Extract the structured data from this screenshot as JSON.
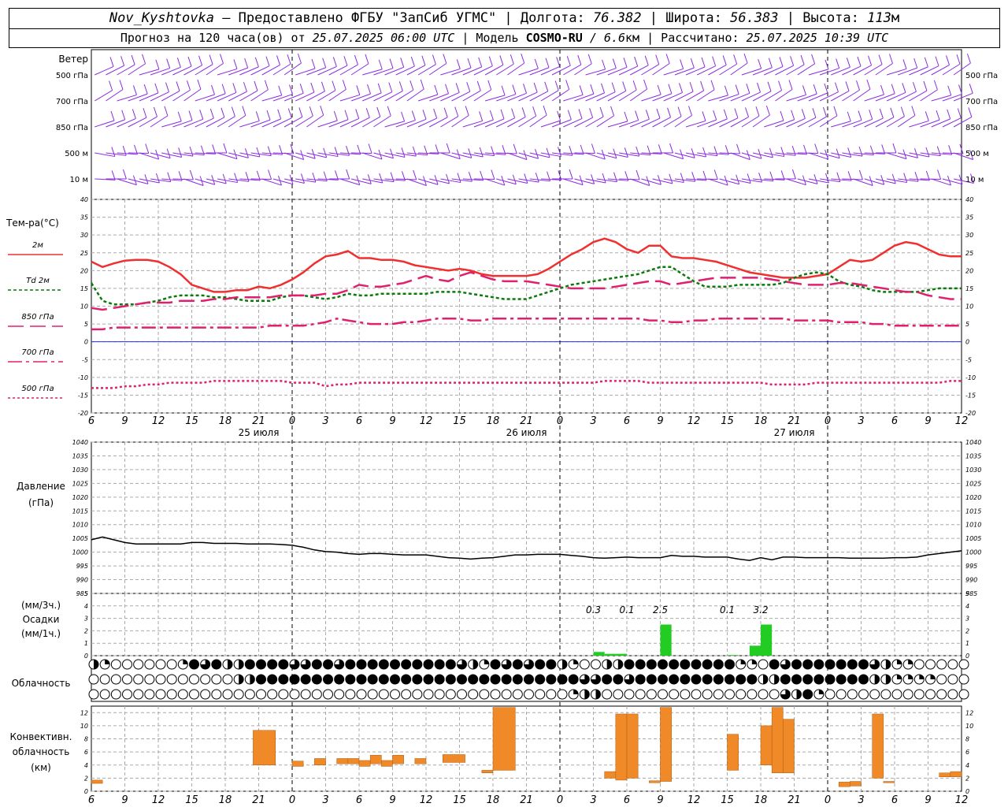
{
  "header": {
    "station": "Nov_Kyshtovka",
    "provided_by": "– Предоставлено ФГБУ \"ЗапСиб УГМС\"",
    "lon_label": "Долгота:",
    "lon_value": "76.382",
    "lat_label": "Широта:",
    "lat_value": "56.383",
    "alt_label": "Высота:",
    "alt_value": "113",
    "alt_unit": "м",
    "forecast_prefix": "Прогноз на 120 часа(ов) от",
    "forecast_time": "25.07.2025 06:00 UTC",
    "model_label": "| Модель",
    "model_name": "COSMO-RU",
    "model_res": "/ 6.6",
    "model_res_unit": "км",
    "computed_label": "| Рассчитано:",
    "computed_time": "25.07.2025 10:39 UTC"
  },
  "x_axis": {
    "hour_labels": [
      "6",
      "9",
      "12",
      "15",
      "18",
      "21",
      "0",
      "3",
      "6",
      "9",
      "12",
      "15",
      "18",
      "21",
      "0",
      "3",
      "6",
      "9",
      "12",
      "15",
      "18",
      "21",
      "0",
      "3",
      "6",
      "9",
      "12"
    ],
    "day_labels": [
      {
        "text": "25 июля",
        "hour": 15
      },
      {
        "text": "26 июля",
        "hour": 39
      },
      {
        "text": "27 июля",
        "hour": 63
      }
    ],
    "midnight_hours": [
      18,
      42,
      66
    ]
  },
  "wind_panel": {
    "title": "Ветер",
    "levels": [
      "500 гПа",
      "700 гПа",
      "850 гПа",
      "500 м",
      "10 м"
    ],
    "barb_color": "#8a2be2"
  },
  "temp_panel": {
    "title": "Тем-ра(°C)",
    "ylim": [
      -20,
      40
    ],
    "yticks": [
      40,
      35,
      30,
      25,
      20,
      15,
      10,
      5,
      0,
      -5,
      -10,
      -15,
      -20
    ],
    "legend": [
      {
        "label": "2м",
        "color": "#f03030"
      },
      {
        "label": "Td  2м",
        "color": "#0a7a0a"
      },
      {
        "label": "850 гПа",
        "color": "#e0206e"
      },
      {
        "label": "700 гПа",
        "color": "#e0206e"
      },
      {
        "label": "500 гПа",
        "color": "#e0206e"
      }
    ]
  },
  "pressure_panel": {
    "title_line1": "Давление",
    "title_line2": "(гПа)",
    "ylim": [
      985,
      1040
    ],
    "yticks": [
      1040,
      1035,
      1030,
      1025,
      1020,
      1015,
      1010,
      1005,
      1000,
      995,
      990,
      985
    ]
  },
  "precip_panel": {
    "title_line1": "(мм/3ч.)",
    "title_line2": "Осадки",
    "title_line3": "(мм/1ч.)",
    "ylim": [
      0,
      5
    ],
    "yticks": [
      5,
      4,
      3,
      2,
      1,
      0
    ],
    "totals": [
      {
        "text": "0.3",
        "hour": 45
      },
      {
        "text": "0.1",
        "hour": 48
      },
      {
        "text": "2.5",
        "hour": 51
      },
      {
        "text": "0.1",
        "hour": 57
      },
      {
        "text": "3.2",
        "hour": 60
      }
    ],
    "color": "#22cc22"
  },
  "cloud_panel": {
    "title": "Облачность"
  },
  "conv_panel": {
    "title_line1": "Конвективн.",
    "title_line2": "облачность",
    "title_line3": "(км)",
    "ylim": [
      0,
      13
    ],
    "yticks": [
      12,
      10,
      8,
      6,
      4,
      2,
      0
    ],
    "color": "#f08a28"
  },
  "chart_data": {
    "type": "line",
    "x_hours_from_start": [
      0,
      1,
      2,
      3,
      4,
      5,
      6,
      7,
      8,
      9,
      10,
      11,
      12,
      13,
      14,
      15,
      16,
      17,
      18,
      19,
      20,
      21,
      22,
      23,
      24,
      25,
      26,
      27,
      28,
      29,
      30,
      31,
      32,
      33,
      34,
      35,
      36,
      37,
      38,
      39,
      40,
      41,
      42,
      43,
      44,
      45,
      46,
      47,
      48,
      49,
      50,
      51,
      52,
      53,
      54,
      55,
      56,
      57,
      58,
      59,
      60,
      61,
      62,
      63,
      64,
      65,
      66,
      67,
      68,
      69,
      70,
      71,
      72,
      73,
      74,
      75,
      76,
      77,
      78
    ],
    "series": [
      {
        "name": "2м",
        "color": "#f03030",
        "dash": "",
        "values": [
          22.5,
          21,
          22,
          22.8,
          23,
          23,
          22.5,
          21,
          19,
          16,
          15,
          14,
          14,
          14.5,
          14.5,
          15.5,
          15,
          16,
          17.5,
          19.5,
          22,
          24,
          24.5,
          25.5,
          23.5,
          23.5,
          23,
          23,
          22.5,
          21.5,
          21,
          20.5,
          20,
          20.5,
          20,
          19,
          18.5,
          18.5,
          18.5,
          18.5,
          19,
          20.5,
          22.5,
          24.5,
          26,
          28,
          29,
          28,
          26,
          25,
          27,
          27,
          24,
          23.5,
          23.5,
          23,
          22.5,
          21.5,
          20.5,
          19.5,
          19,
          18.5,
          18,
          18,
          18,
          18.5,
          19,
          21,
          23,
          22.5,
          23,
          25,
          27,
          28,
          27.5,
          26,
          24.5,
          24,
          24
        ]
      },
      {
        "name": "Td 2м",
        "color": "#0a7a0a",
        "dash": "4,3",
        "values": [
          16.5,
          11.5,
          10.5,
          10.5,
          10.5,
          11,
          11.5,
          12.5,
          13,
          13,
          13,
          12.5,
          12.5,
          12,
          11.5,
          11.5,
          11.5,
          12.5,
          13,
          13,
          12.5,
          12,
          12.5,
          13.5,
          13,
          13,
          13.5,
          13.5,
          13.5,
          13.5,
          13.5,
          14,
          14,
          14,
          13.5,
          13,
          12.5,
          12,
          12,
          12,
          13,
          14,
          15,
          16,
          16.5,
          17,
          17.5,
          18,
          18.5,
          19,
          20,
          21,
          21,
          19,
          17,
          15.5,
          15.5,
          15.5,
          16,
          16,
          16,
          16,
          16.5,
          18,
          19,
          19.5,
          19,
          17,
          16,
          15.5,
          14.5,
          14,
          14,
          14,
          14,
          14.5,
          15,
          15,
          15
        ]
      },
      {
        "name": "850 гПа",
        "color": "#e0206e",
        "dash": "20,8",
        "values": [
          9.5,
          9,
          9.5,
          10,
          10.5,
          11,
          11,
          11,
          11.5,
          11.5,
          11.5,
          12,
          12,
          12.5,
          12.5,
          12.5,
          12.5,
          13,
          13,
          13,
          13,
          13.5,
          13.5,
          14.5,
          16,
          15.5,
          15.5,
          16,
          16.5,
          17.5,
          18.5,
          17.5,
          17,
          18.5,
          19.5,
          18.5,
          17.5,
          17,
          17,
          17,
          16.5,
          16,
          15.5,
          15,
          15,
          15,
          15,
          15.5,
          16,
          16.5,
          17,
          17,
          16,
          16.5,
          17,
          17.5,
          18,
          18,
          18,
          18,
          18,
          17.5,
          17,
          16.5,
          16,
          16,
          16,
          16.5,
          16.5,
          16,
          15.5,
          15,
          14.5,
          14,
          14,
          13,
          12.5,
          12,
          12
        ]
      },
      {
        "name": "700 гПа",
        "color": "#e0206e",
        "dash": "18,5,4,5",
        "values": [
          3.5,
          3.5,
          4,
          4,
          4,
          4,
          4,
          4,
          4,
          4,
          4,
          4,
          4,
          4,
          4,
          4,
          4.5,
          4.5,
          4.5,
          4.5,
          5,
          5.5,
          6.5,
          6,
          5.5,
          5,
          5,
          5,
          5.5,
          5.5,
          6,
          6.5,
          6.5,
          6.5,
          6,
          6,
          6.5,
          6.5,
          6.5,
          6.5,
          6.5,
          6.5,
          6.5,
          6.5,
          6.5,
          6.5,
          6.5,
          6.5,
          6.5,
          6.5,
          6,
          6,
          5.5,
          5.5,
          6,
          6,
          6.5,
          6.5,
          6.5,
          6.5,
          6.5,
          6.5,
          6.5,
          6,
          6,
          6,
          6,
          5.5,
          5.5,
          5.5,
          5,
          5,
          4.5,
          4.5,
          4.5,
          4.5,
          4.5,
          4.5,
          4.5
        ]
      },
      {
        "name": "500 гПа",
        "color": "#e0206e",
        "dash": "3,3",
        "values": [
          -13,
          -13,
          -13,
          -12.5,
          -12.5,
          -12,
          -12,
          -11.5,
          -11.5,
          -11.5,
          -11.5,
          -11,
          -11,
          -11,
          -11,
          -11,
          -11,
          -11,
          -11.5,
          -11.5,
          -11.5,
          -12.5,
          -12,
          -12,
          -11.5,
          -11.5,
          -11.5,
          -11.5,
          -11.5,
          -11.5,
          -11.5,
          -11.5,
          -11.5,
          -11.5,
          -11.5,
          -11.5,
          -11.5,
          -11.5,
          -11.5,
          -11.5,
          -11.5,
          -11.5,
          -11.5,
          -11.5,
          -11.5,
          -11.5,
          -11,
          -11,
          -11,
          -11,
          -11.5,
          -11.5,
          -11.5,
          -11.5,
          -11.5,
          -11.5,
          -11.5,
          -11.5,
          -11.5,
          -11.5,
          -11.5,
          -12,
          -12,
          -12,
          -12,
          -11.5,
          -11.5,
          -11.5,
          -11.5,
          -11.5,
          -11.5,
          -11.5,
          -11.5,
          -11.5,
          -11.5,
          -11.5,
          -11.5,
          -11,
          -11
        ]
      }
    ],
    "pressure": [
      1004.5,
      1005.5,
      1004.5,
      1003.5,
      1003,
      1003,
      1003,
      1003,
      1003,
      1003.5,
      1003.5,
      1003.2,
      1003.2,
      1003.2,
      1003,
      1003,
      1003,
      1002.8,
      1002.5,
      1001.8,
      1000.8,
      1000.2,
      1000,
      999.5,
      999.2,
      999.5,
      999.5,
      999.2,
      999,
      999,
      999,
      998.5,
      998,
      997.8,
      997.5,
      997.8,
      998,
      998.5,
      999,
      999,
      999.2,
      999.2,
      999.2,
      998.8,
      998.5,
      998,
      997.8,
      998,
      998.2,
      998,
      998,
      998,
      998.8,
      998.5,
      998.5,
      998.2,
      998.2,
      998.2,
      997.5,
      997,
      998,
      997.2,
      998.2,
      998.2,
      998,
      998,
      998,
      998,
      997.8,
      997.8,
      997.8,
      997.8,
      998,
      998,
      998.2,
      999,
      999.5,
      1000,
      1000.5
    ],
    "precip_bars": [
      {
        "hour": 45,
        "width": 1,
        "value": 0.3
      },
      {
        "hour": 46,
        "width": 1,
        "value": 0.15
      },
      {
        "hour": 47,
        "width": 1,
        "value": 0.15
      },
      {
        "hour": 51,
        "width": 1,
        "value": 2.5
      },
      {
        "hour": 57,
        "width": 1,
        "value": 0.05
      },
      {
        "hour": 59,
        "width": 1,
        "value": 0.8
      },
      {
        "hour": 60,
        "width": 1,
        "value": 2.5
      }
    ],
    "conv_bars": [
      {
        "hour": 0.5,
        "width": 1,
        "base": 1.2,
        "top": 1.7
      },
      {
        "hour": 15.5,
        "width": 2,
        "base": 4,
        "top": 9.3
      },
      {
        "hour": 18.5,
        "width": 1,
        "base": 3.8,
        "top": 4.6
      },
      {
        "hour": 20.5,
        "width": 1,
        "base": 4,
        "top": 5
      },
      {
        "hour": 22.5,
        "width": 1,
        "base": 4.2,
        "top": 5
      },
      {
        "hour": 23.5,
        "width": 1,
        "base": 4.2,
        "top": 5
      },
      {
        "hour": 24.5,
        "width": 1,
        "base": 3.8,
        "top": 4.7
      },
      {
        "hour": 25.5,
        "width": 1,
        "base": 4.2,
        "top": 5.5
      },
      {
        "hour": 26.5,
        "width": 1,
        "base": 3.8,
        "top": 4.7
      },
      {
        "hour": 27.5,
        "width": 1,
        "base": 4.2,
        "top": 5.5
      },
      {
        "hour": 29.5,
        "width": 1,
        "base": 4.2,
        "top": 5
      },
      {
        "hour": 32.5,
        "width": 2,
        "base": 4.4,
        "top": 5.6
      },
      {
        "hour": 35.5,
        "width": 1,
        "base": 2.8,
        "top": 3.2
      },
      {
        "hour": 37,
        "width": 2,
        "base": 3.2,
        "top": 12.8
      },
      {
        "hour": 46.5,
        "width": 1,
        "base": 2,
        "top": 3
      },
      {
        "hour": 47.5,
        "width": 1,
        "base": 1.7,
        "top": 11.8
      },
      {
        "hour": 48.5,
        "width": 1,
        "base": 2,
        "top": 11.8
      },
      {
        "hour": 50.5,
        "width": 1,
        "base": 1.3,
        "top": 1.6
      },
      {
        "hour": 51.5,
        "width": 1,
        "base": 1.5,
        "top": 12.8
      },
      {
        "hour": 57.5,
        "width": 1,
        "base": 3.2,
        "top": 8.7
      },
      {
        "hour": 60.5,
        "width": 1,
        "base": 4,
        "top": 10
      },
      {
        "hour": 61.5,
        "width": 1,
        "base": 2.8,
        "top": 12.8
      },
      {
        "hour": 62.5,
        "width": 1,
        "base": 2.8,
        "top": 11
      },
      {
        "hour": 67.5,
        "width": 1,
        "base": 0.7,
        "top": 1.4
      },
      {
        "hour": 68.5,
        "width": 1,
        "base": 0.8,
        "top": 1.5
      },
      {
        "hour": 70.5,
        "width": 1,
        "base": 2,
        "top": 11.8
      },
      {
        "hour": 71.5,
        "width": 1,
        "base": 1.3,
        "top": 1.5
      },
      {
        "hour": 76.5,
        "width": 1,
        "base": 2.2,
        "top": 2.8
      },
      {
        "hour": 77.5,
        "width": 1,
        "base": 2.2,
        "top": 3
      }
    ],
    "cloud_cover_octas": {
      "high": [
        4,
        2,
        0,
        0,
        0,
        0,
        0,
        0,
        2,
        8,
        6,
        8,
        4,
        4,
        8,
        8,
        8,
        8,
        6,
        6,
        8,
        8,
        6,
        8,
        8,
        8,
        8,
        8,
        8,
        8,
        8,
        8,
        8,
        6,
        4,
        2,
        8,
        6,
        8,
        6,
        8,
        8,
        4,
        2,
        0,
        0,
        4,
        4,
        8,
        8,
        8,
        8,
        8,
        8,
        8,
        8,
        8,
        8,
        2,
        2,
        0,
        8,
        6,
        8,
        8,
        8,
        8,
        8,
        8,
        8,
        6,
        4,
        2,
        2,
        0,
        0,
        0,
        0,
        0,
        0,
        0,
        0,
        0
      ],
      "middle": [
        0,
        0,
        0,
        0,
        0,
        0,
        0,
        0,
        0,
        0,
        0,
        0,
        0,
        4,
        4,
        8,
        8,
        8,
        8,
        8,
        8,
        8,
        8,
        8,
        8,
        8,
        8,
        8,
        8,
        8,
        8,
        8,
        8,
        8,
        8,
        8,
        8,
        8,
        8,
        8,
        8,
        8,
        8,
        8,
        6,
        6,
        8,
        8,
        6,
        8,
        8,
        8,
        8,
        8,
        8,
        8,
        8,
        8,
        8,
        8,
        4,
        4,
        8,
        8,
        8,
        8,
        8,
        8,
        8,
        8,
        4,
        4,
        2,
        2,
        2,
        2,
        0,
        0,
        0,
        0,
        0,
        0
      ],
      "low": [
        0,
        0,
        0,
        0,
        0,
        0,
        0,
        0,
        0,
        0,
        0,
        0,
        0,
        0,
        0,
        0,
        0,
        0,
        0,
        0,
        0,
        0,
        0,
        0,
        0,
        0,
        0,
        0,
        0,
        0,
        0,
        0,
        0,
        0,
        0,
        0,
        0,
        0,
        0,
        0,
        0,
        0,
        0,
        2,
        4,
        4,
        0,
        0,
        0,
        0,
        0,
        0,
        0,
        0,
        0,
        0,
        0,
        0,
        0,
        0,
        0,
        0,
        6,
        4,
        8,
        2,
        0,
        0,
        0,
        0,
        0,
        0,
        0,
        0,
        0,
        0,
        0,
        0,
        0,
        0,
        8,
        8,
        0,
        0,
        0,
        0,
        0,
        0,
        0,
        0,
        4
      ]
    }
  }
}
